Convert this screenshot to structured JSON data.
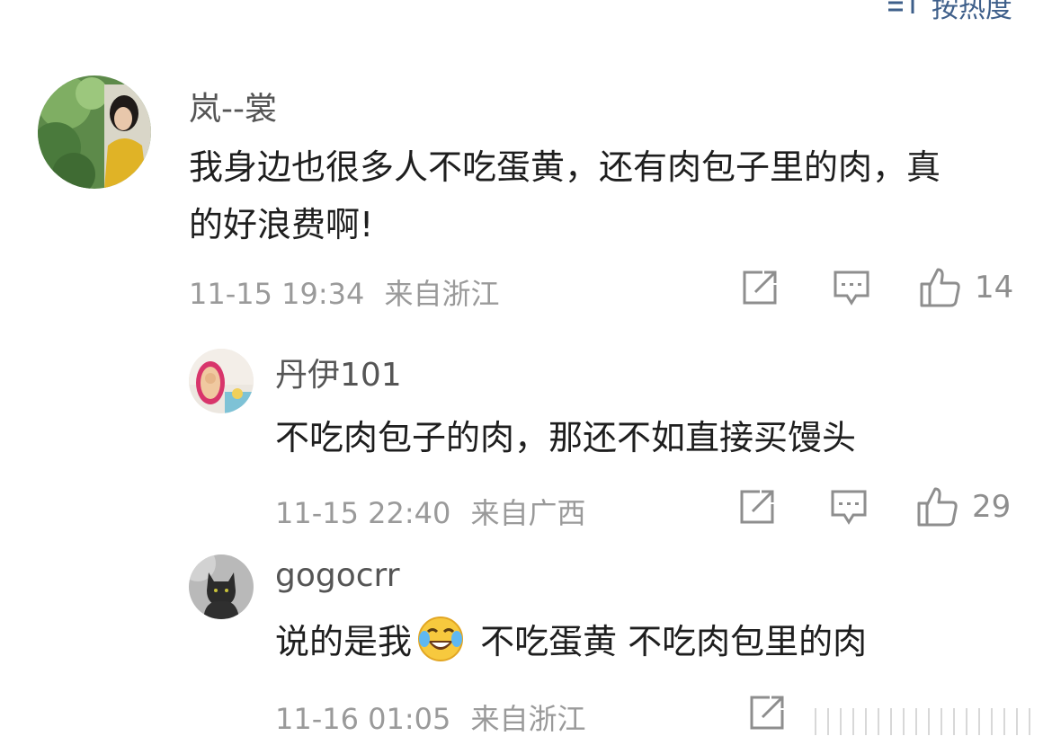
{
  "sort": {
    "label": "按热度"
  },
  "comments": [
    {
      "username": "岚--裳",
      "content": "我身边也很多人不吃蛋黄，还有肉包子里的肉，真的好浪费啊!",
      "time": "11-15 19:34",
      "location": "来自浙江",
      "likes": "14"
    },
    {
      "username": "丹伊101",
      "content": "不吃肉包子的肉，那还不如直接买馒头",
      "time": "11-15 22:40",
      "location": "来自广西",
      "likes": "29"
    },
    {
      "username": "gogocrr",
      "content_before": "说的是我",
      "content_after": " 不吃蛋黄 不吃肉包里的肉",
      "emoji": "laugh-cry-emoji",
      "time": "11-16 01:05",
      "location": "来自浙江"
    }
  ],
  "icons": {
    "share": "share-icon",
    "comment": "comment-icon",
    "like": "thumbs-up-icon"
  },
  "colors": {
    "link_blue": "#3e5f8a",
    "meta_gray": "#9a9a9a",
    "icon_gray": "#8e8e8e"
  }
}
